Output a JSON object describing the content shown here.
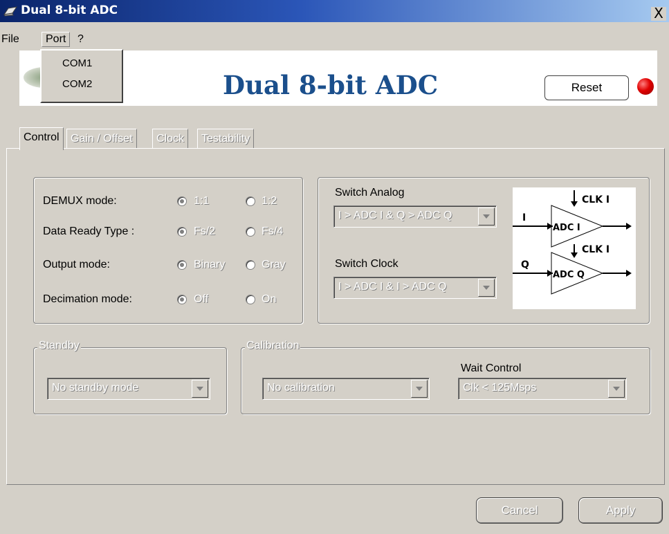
{
  "window": {
    "title": "Dual 8-bit ADC",
    "close": "X"
  },
  "menu": {
    "file": "File",
    "port": "Port",
    "help": "?"
  },
  "port_menu": {
    "items": [
      "COM1",
      "COM2"
    ]
  },
  "banner": {
    "title": "Dual 8-bit ADC",
    "reset": "Reset",
    "led_color": "#e00000"
  },
  "tabs": [
    "Control",
    "Gain / Offset",
    "Clock",
    "Testability"
  ],
  "control": {
    "rows": [
      {
        "label": "DEMUX mode:",
        "opt1": "1:1",
        "opt2": "1:2",
        "selected": "1:1"
      },
      {
        "label": "Data Ready Type :",
        "opt1": "Fs/2",
        "opt2": "Fs/4",
        "selected": "Fs/2"
      },
      {
        "label": "Output mode:",
        "opt1": "Binary",
        "opt2": "Gray",
        "selected": "Binary"
      },
      {
        "label": "Decimation mode:",
        "opt1": "Off",
        "opt2": "On",
        "selected": "Off"
      }
    ],
    "switch_analog": {
      "label": "Switch Analog",
      "value": "I > ADC I  &  Q > ADC Q"
    },
    "switch_clock": {
      "label": "Switch Clock",
      "value": "I > ADC I  &  I > ADC Q"
    },
    "diagram": {
      "clk1": "CLK I",
      "clk2": "CLK I",
      "in_i": "I",
      "in_q": "Q",
      "adc_i": "ADC I",
      "adc_q": "ADC Q"
    },
    "standby": {
      "legend": "Standby",
      "value": "No standby mode"
    },
    "calibration": {
      "legend": "Calibration",
      "value": "No calibration",
      "wait_label": "Wait Control",
      "wait_value": "Clk < 125Msps"
    }
  },
  "footer": {
    "cancel": "Cancel",
    "apply": "Apply"
  }
}
